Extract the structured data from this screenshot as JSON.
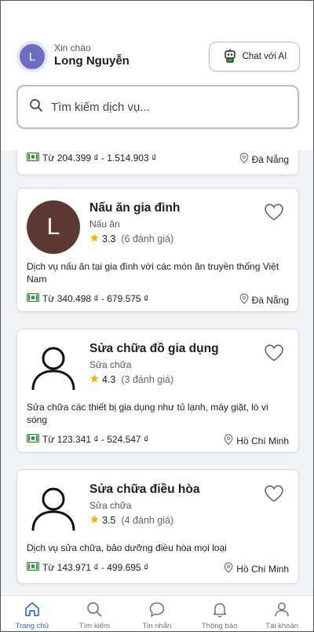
{
  "header": {
    "avatar_letter": "L",
    "greeting": "Xin chào",
    "user_name": "Long Nguyễn",
    "chat_button_label": "Chat với AI"
  },
  "search": {
    "placeholder": "Tìm kiếm dịch vụ..."
  },
  "partial_card": {
    "price": "Từ 204.399 ₫ - 1.514.903 ₫",
    "location": "Đà Nẵng"
  },
  "services": [
    {
      "avatar_letter": "L",
      "name": "Nấu ăn gia đình",
      "category": "Nấu ăn",
      "rating": "3.3",
      "reviews": "(6 đánh giá)",
      "description": "Dịch vụ nấu ăn tại gia đình với các món ăn truyền thống Việt Nam",
      "price": "Từ 340.498 ₫ - 679.575 ₫",
      "location": "Đà Nẵng"
    },
    {
      "avatar_letter": "",
      "name": "Sửa chữa đồ gia dụng",
      "category": "Sửa chữa",
      "rating": "4.3",
      "reviews": "(3 đánh giá)",
      "description": "Sửa chữa các thiết bị gia dụng như tủ lạnh, máy giặt, lò vi sóng",
      "price": "Từ 123.341 ₫ - 524.547 ₫",
      "location": "Hồ Chí Minh"
    },
    {
      "avatar_letter": "",
      "name": "Sửa chữa điều hòa",
      "category": "Sửa chữa",
      "rating": "3.5",
      "reviews": "(4 đánh giá)",
      "description": "Dịch vụ sửa chữa, bảo dưỡng điều hòa mọi loại",
      "price": "Từ 143.971 ₫ - 499.695 ₫",
      "location": "Hồ Chí Minh"
    }
  ],
  "nav": [
    {
      "label": "Trang chủ",
      "icon": "home-icon",
      "active": true
    },
    {
      "label": "Tìm kiếm",
      "icon": "search-icon",
      "active": false
    },
    {
      "label": "Tin nhắn",
      "icon": "chat-bubble-icon",
      "active": false
    },
    {
      "label": "Thông báo",
      "icon": "bell-icon",
      "active": false
    },
    {
      "label": "Tài khoản",
      "icon": "user-icon",
      "active": false
    }
  ],
  "colors": {
    "accent": "#2f6fd6",
    "star": "#f5b400",
    "money": "#2e8b3a",
    "avatar_brown": "#5c3a33",
    "avatar_small": "#6a6fc4"
  }
}
